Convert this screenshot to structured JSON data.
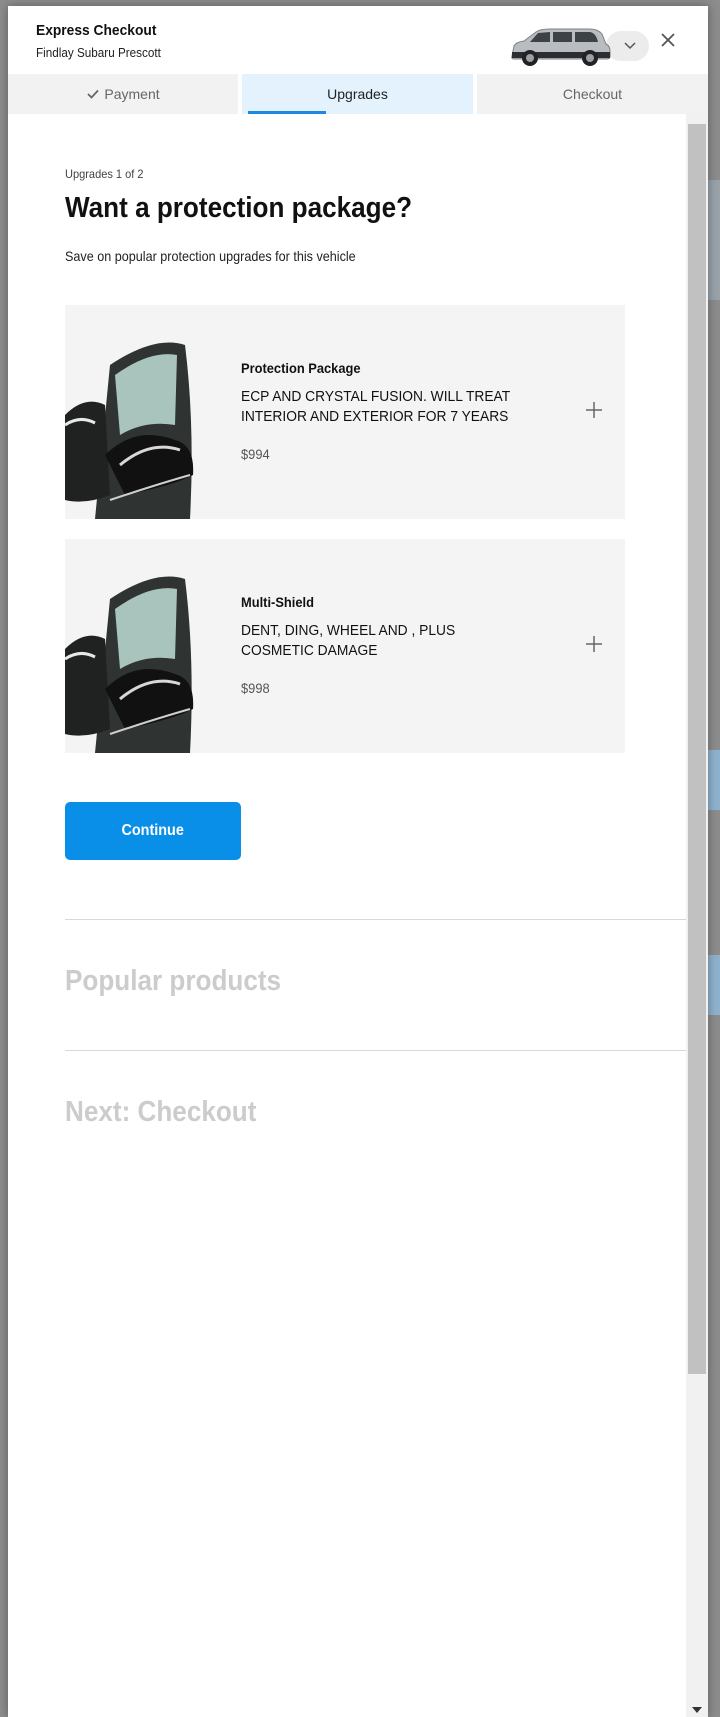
{
  "modal": {
    "title": "Express Checkout",
    "subtitle": "Findlay Subaru Prescott",
    "vehicle_icon": "car-thumbnail",
    "close_icon": "close-icon"
  },
  "tabs": [
    {
      "label": "Payment",
      "state": "completed"
    },
    {
      "label": "Upgrades",
      "state": "active"
    },
    {
      "label": "Checkout",
      "state": "pending"
    }
  ],
  "upgrades": {
    "step_label": "Upgrades 1 of 2",
    "title": "Want a protection package?",
    "description": "Save on popular protection upgrades for this vehicle",
    "products": [
      {
        "name": "Protection Package",
        "description": "ECP AND CRYSTAL FUSION. WILL TREAT INTERIOR AND EXTERIOR FOR 7 YEARS",
        "price": "$994"
      },
      {
        "name": "Multi-Shield",
        "description": "DENT, DING, WHEEL AND , PLUS COSMETIC DAMAGE",
        "price": "$998"
      }
    ],
    "continue_label": "Continue"
  },
  "sections": {
    "popular": "Popular products",
    "next": "Next: Checkout"
  },
  "colors": {
    "accent": "#0a8fe8",
    "tab_active_bg": "#e3f2fd",
    "card_bg": "#f4f4f4",
    "muted_heading": "#cccccc"
  }
}
